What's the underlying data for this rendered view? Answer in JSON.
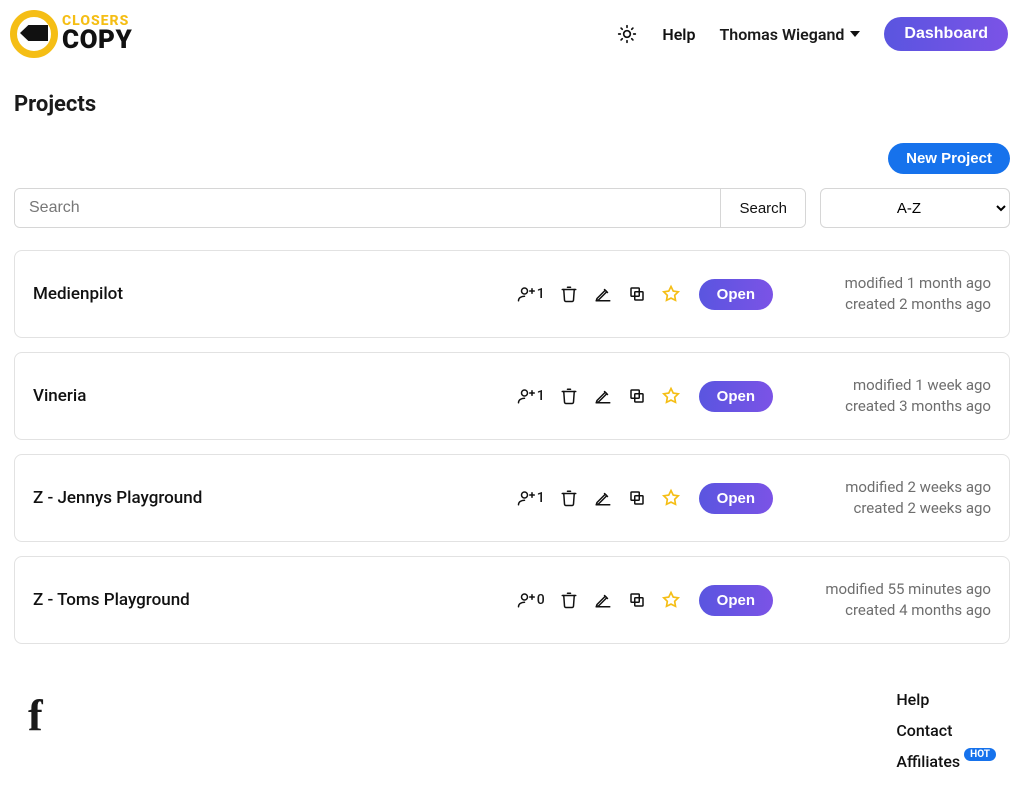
{
  "brand": {
    "top": "CLOSERS",
    "bottom": "COPY"
  },
  "nav": {
    "help": "Help",
    "user_name": "Thomas Wiegand",
    "dashboard": "Dashboard"
  },
  "page": {
    "title": "Projects",
    "new_project": "New Project",
    "search_placeholder": "Search",
    "search_button": "Search",
    "sort_label": "A-Z"
  },
  "open_label": "Open",
  "projects": [
    {
      "name": "Medienpilot",
      "collaborators": "1",
      "modified": "modified 1 month ago",
      "created": "created 2 months ago"
    },
    {
      "name": "Vineria",
      "collaborators": "1",
      "modified": "modified 1 week ago",
      "created": "created 3 months ago"
    },
    {
      "name": "Z - Jennys Playground",
      "collaborators": "1",
      "modified": "modified 2 weeks ago",
      "created": "created 2 weeks ago"
    },
    {
      "name": "Z - Toms Playground",
      "collaborators": "0",
      "modified": "modified 55 minutes ago",
      "created": "created 4 months ago"
    }
  ],
  "footer": {
    "help": "Help",
    "contact": "Contact",
    "affiliates": "Affiliates",
    "affiliates_badge": "HOT"
  }
}
